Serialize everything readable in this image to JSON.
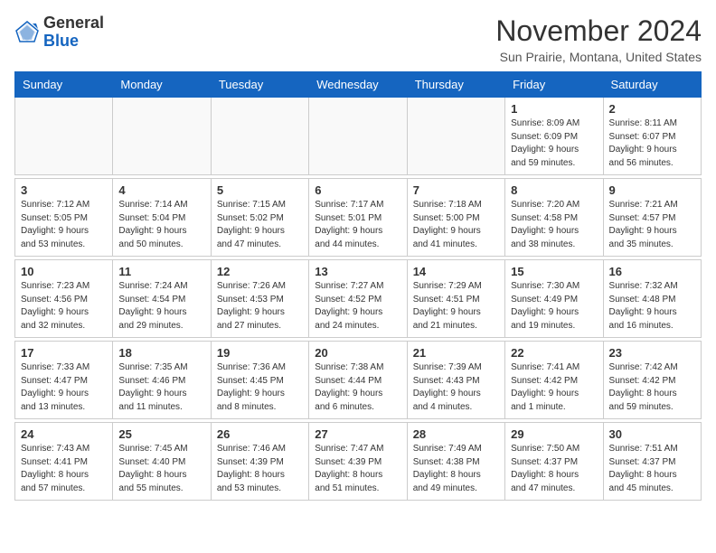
{
  "header": {
    "logo_general": "General",
    "logo_blue": "Blue",
    "month_year": "November 2024",
    "location": "Sun Prairie, Montana, United States"
  },
  "weekdays": [
    "Sunday",
    "Monday",
    "Tuesday",
    "Wednesday",
    "Thursday",
    "Friday",
    "Saturday"
  ],
  "weeks": [
    [
      {
        "day": "",
        "info": ""
      },
      {
        "day": "",
        "info": ""
      },
      {
        "day": "",
        "info": ""
      },
      {
        "day": "",
        "info": ""
      },
      {
        "day": "",
        "info": ""
      },
      {
        "day": "1",
        "info": "Sunrise: 8:09 AM\nSunset: 6:09 PM\nDaylight: 9 hours\nand 59 minutes."
      },
      {
        "day": "2",
        "info": "Sunrise: 8:11 AM\nSunset: 6:07 PM\nDaylight: 9 hours\nand 56 minutes."
      }
    ],
    [
      {
        "day": "3",
        "info": "Sunrise: 7:12 AM\nSunset: 5:05 PM\nDaylight: 9 hours\nand 53 minutes."
      },
      {
        "day": "4",
        "info": "Sunrise: 7:14 AM\nSunset: 5:04 PM\nDaylight: 9 hours\nand 50 minutes."
      },
      {
        "day": "5",
        "info": "Sunrise: 7:15 AM\nSunset: 5:02 PM\nDaylight: 9 hours\nand 47 minutes."
      },
      {
        "day": "6",
        "info": "Sunrise: 7:17 AM\nSunset: 5:01 PM\nDaylight: 9 hours\nand 44 minutes."
      },
      {
        "day": "7",
        "info": "Sunrise: 7:18 AM\nSunset: 5:00 PM\nDaylight: 9 hours\nand 41 minutes."
      },
      {
        "day": "8",
        "info": "Sunrise: 7:20 AM\nSunset: 4:58 PM\nDaylight: 9 hours\nand 38 minutes."
      },
      {
        "day": "9",
        "info": "Sunrise: 7:21 AM\nSunset: 4:57 PM\nDaylight: 9 hours\nand 35 minutes."
      }
    ],
    [
      {
        "day": "10",
        "info": "Sunrise: 7:23 AM\nSunset: 4:56 PM\nDaylight: 9 hours\nand 32 minutes."
      },
      {
        "day": "11",
        "info": "Sunrise: 7:24 AM\nSunset: 4:54 PM\nDaylight: 9 hours\nand 29 minutes."
      },
      {
        "day": "12",
        "info": "Sunrise: 7:26 AM\nSunset: 4:53 PM\nDaylight: 9 hours\nand 27 minutes."
      },
      {
        "day": "13",
        "info": "Sunrise: 7:27 AM\nSunset: 4:52 PM\nDaylight: 9 hours\nand 24 minutes."
      },
      {
        "day": "14",
        "info": "Sunrise: 7:29 AM\nSunset: 4:51 PM\nDaylight: 9 hours\nand 21 minutes."
      },
      {
        "day": "15",
        "info": "Sunrise: 7:30 AM\nSunset: 4:49 PM\nDaylight: 9 hours\nand 19 minutes."
      },
      {
        "day": "16",
        "info": "Sunrise: 7:32 AM\nSunset: 4:48 PM\nDaylight: 9 hours\nand 16 minutes."
      }
    ],
    [
      {
        "day": "17",
        "info": "Sunrise: 7:33 AM\nSunset: 4:47 PM\nDaylight: 9 hours\nand 13 minutes."
      },
      {
        "day": "18",
        "info": "Sunrise: 7:35 AM\nSunset: 4:46 PM\nDaylight: 9 hours\nand 11 minutes."
      },
      {
        "day": "19",
        "info": "Sunrise: 7:36 AM\nSunset: 4:45 PM\nDaylight: 9 hours\nand 8 minutes."
      },
      {
        "day": "20",
        "info": "Sunrise: 7:38 AM\nSunset: 4:44 PM\nDaylight: 9 hours\nand 6 minutes."
      },
      {
        "day": "21",
        "info": "Sunrise: 7:39 AM\nSunset: 4:43 PM\nDaylight: 9 hours\nand 4 minutes."
      },
      {
        "day": "22",
        "info": "Sunrise: 7:41 AM\nSunset: 4:42 PM\nDaylight: 9 hours\nand 1 minute."
      },
      {
        "day": "23",
        "info": "Sunrise: 7:42 AM\nSunset: 4:42 PM\nDaylight: 8 hours\nand 59 minutes."
      }
    ],
    [
      {
        "day": "24",
        "info": "Sunrise: 7:43 AM\nSunset: 4:41 PM\nDaylight: 8 hours\nand 57 minutes."
      },
      {
        "day": "25",
        "info": "Sunrise: 7:45 AM\nSunset: 4:40 PM\nDaylight: 8 hours\nand 55 minutes."
      },
      {
        "day": "26",
        "info": "Sunrise: 7:46 AM\nSunset: 4:39 PM\nDaylight: 8 hours\nand 53 minutes."
      },
      {
        "day": "27",
        "info": "Sunrise: 7:47 AM\nSunset: 4:39 PM\nDaylight: 8 hours\nand 51 minutes."
      },
      {
        "day": "28",
        "info": "Sunrise: 7:49 AM\nSunset: 4:38 PM\nDaylight: 8 hours\nand 49 minutes."
      },
      {
        "day": "29",
        "info": "Sunrise: 7:50 AM\nSunset: 4:37 PM\nDaylight: 8 hours\nand 47 minutes."
      },
      {
        "day": "30",
        "info": "Sunrise: 7:51 AM\nSunset: 4:37 PM\nDaylight: 8 hours\nand 45 minutes."
      }
    ]
  ]
}
